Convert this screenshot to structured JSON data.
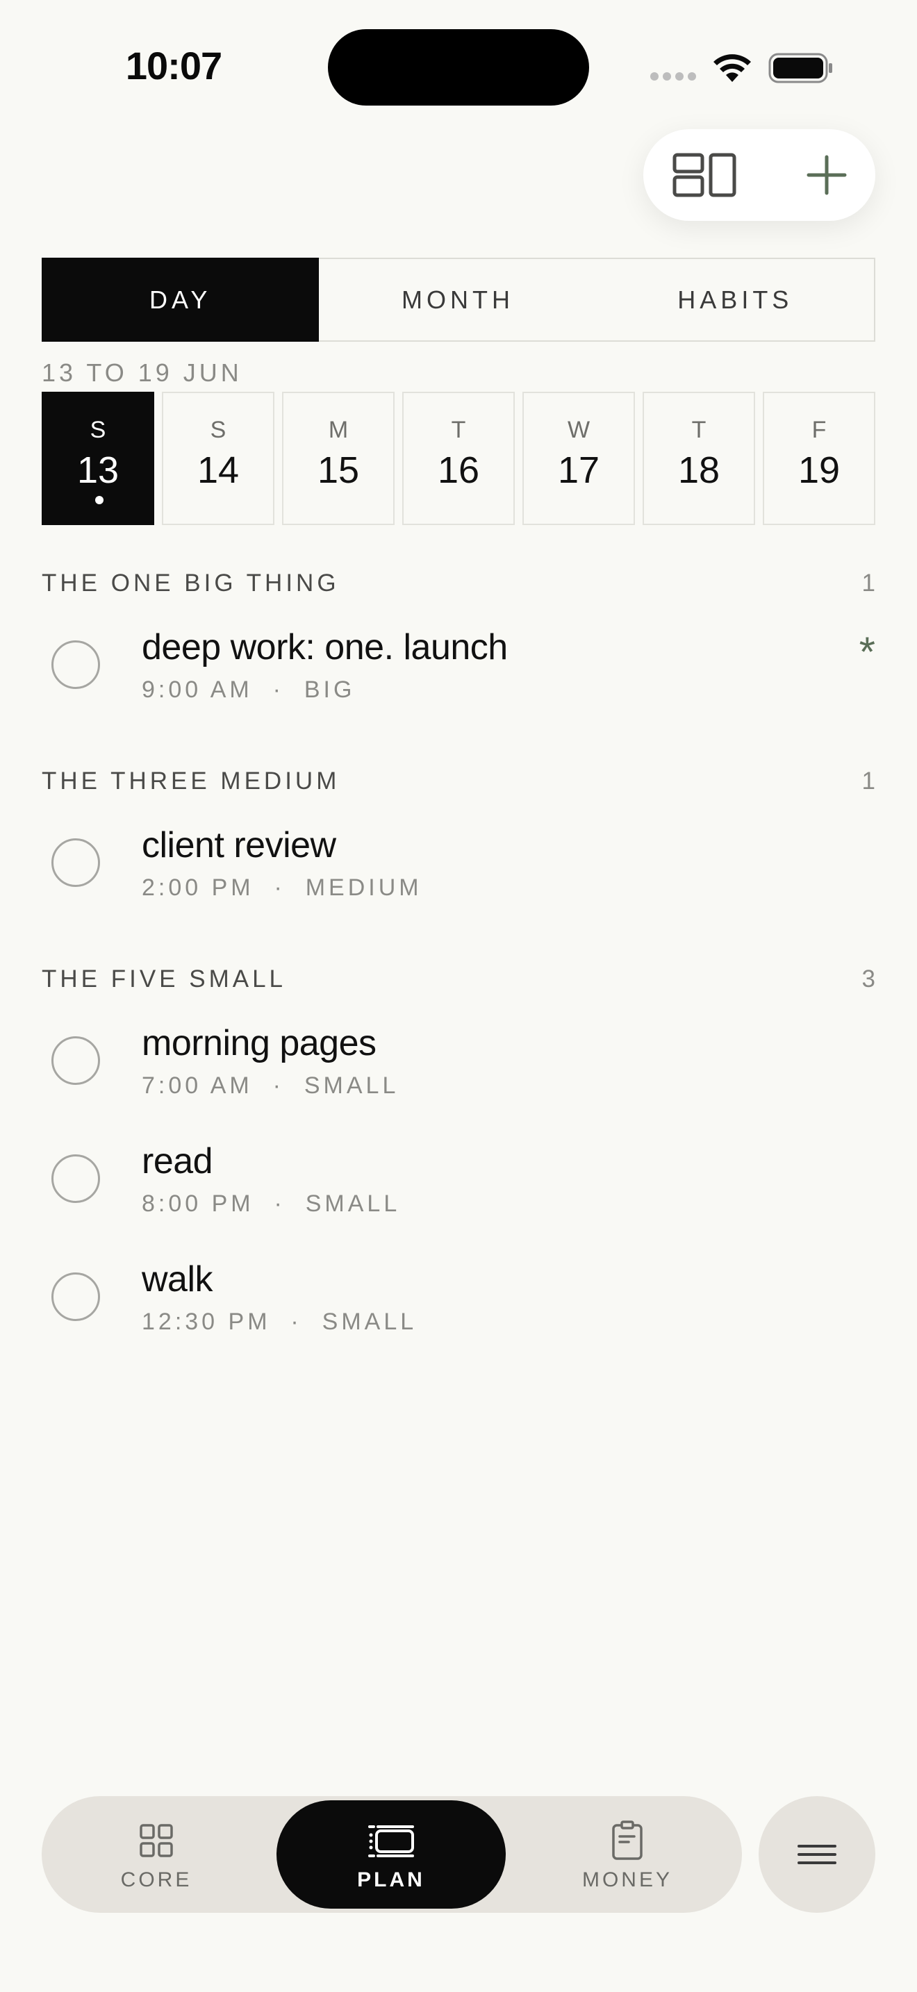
{
  "status_bar": {
    "time": "10:07"
  },
  "tabs": [
    {
      "label": "DAY",
      "active": true
    },
    {
      "label": "MONTH",
      "active": false
    },
    {
      "label": "HABITS",
      "active": false
    }
  ],
  "week": {
    "label": "13 TO 19 JUN",
    "days": [
      {
        "dow": "S",
        "num": "13",
        "selected": true
      },
      {
        "dow": "S",
        "num": "14"
      },
      {
        "dow": "M",
        "num": "15"
      },
      {
        "dow": "T",
        "num": "16"
      },
      {
        "dow": "W",
        "num": "17"
      },
      {
        "dow": "T",
        "num": "18"
      },
      {
        "dow": "F",
        "num": "19"
      }
    ]
  },
  "sections": [
    {
      "title": "THE ONE BIG THING",
      "count": "1",
      "tasks": [
        {
          "title": "deep work: one. launch",
          "time": "9:00 AM",
          "size": "BIG",
          "marker": "*"
        }
      ]
    },
    {
      "title": "THE THREE MEDIUM",
      "count": "1",
      "tasks": [
        {
          "title": "client review",
          "time": "2:00 PM",
          "size": "MEDIUM"
        }
      ]
    },
    {
      "title": "THE FIVE SMALL",
      "count": "3",
      "tasks": [
        {
          "title": "morning pages",
          "time": "7:00 AM",
          "size": "SMALL"
        },
        {
          "title": "read",
          "time": "8:00 PM",
          "size": "SMALL"
        },
        {
          "title": "walk",
          "time": "12:30 PM",
          "size": "SMALL"
        }
      ]
    }
  ],
  "meta_separator": "  ·  ",
  "nav": {
    "items": [
      {
        "label": "CORE",
        "icon": "grid-icon"
      },
      {
        "label": "PLAN",
        "icon": "plan-icon",
        "active": true
      },
      {
        "label": "MONEY",
        "icon": "clipboard-icon"
      }
    ],
    "menu_icon": "menu-icon"
  },
  "fab": {
    "layout_icon": "layout-icon",
    "add_icon": "plus-icon"
  },
  "colors": {
    "accent": "#5a6e57",
    "background": "#f9f9f5",
    "active": "#0b0b0b"
  }
}
